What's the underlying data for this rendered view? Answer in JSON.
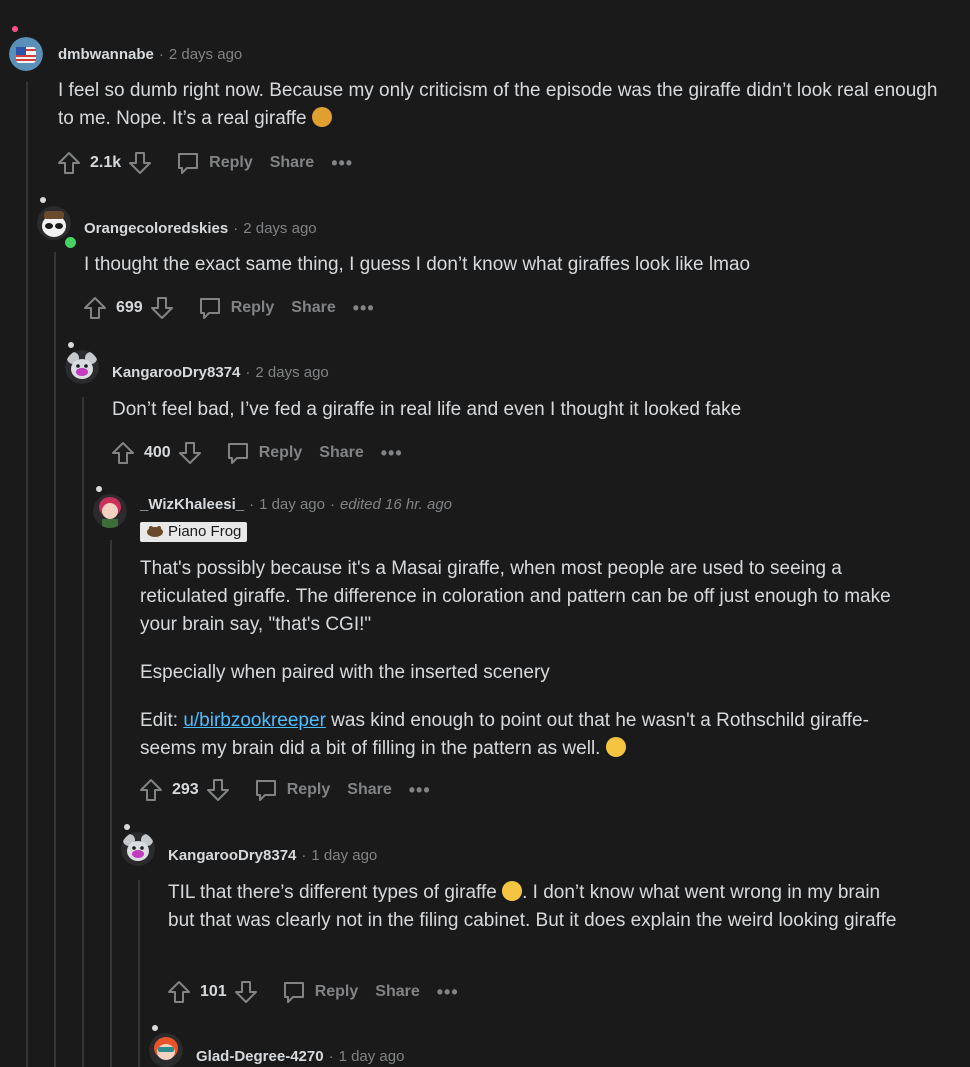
{
  "comments": [
    {
      "username": "dmbwannabe",
      "time": "2 days ago",
      "body": [
        "I feel so dumb right now. Because my only criticism of the episode was the giraffe didn’t look real enough to me. Nope. It’s a real giraffe"
      ],
      "score": "2.1k",
      "emoji": "giraffe-emoji"
    },
    {
      "username": "Orangecoloredskies",
      "time": "2 days ago",
      "body": [
        "I thought the exact same thing, I guess I don’t know what giraffes look like lmao"
      ],
      "score": "699"
    },
    {
      "username": "KangarooDry8374",
      "time": "2 days ago",
      "body": [
        "Don’t feel bad, I’ve fed a giraffe in real life and even I thought it looked fake"
      ],
      "score": "400"
    },
    {
      "username": "_WizKhaleesi_",
      "time": "1 day ago",
      "edited": "edited 16 hr. ago",
      "flair": "Piano Frog",
      "body": [
        "That's possibly because it's a Masai giraffe, when most people are used to seeing a reticulated giraffe. The difference in coloration and pattern can be off just enough to make your brain say, \"that's CGI!\"",
        "Especially when paired with the inserted scenery"
      ],
      "edit_prefix": "Edit: ",
      "edit_link": "u/birbzookreeper",
      "edit_rest": " was kind enough to point out that he wasn't a Rothschild giraffe- seems my brain did a bit of filling in the pattern as well.",
      "score": "293"
    },
    {
      "username": "KangarooDry8374",
      "time": "1 day ago",
      "body_pre": "TIL that there’s different types of giraffe ",
      "body_post": ". I don’t know what went wrong in my brain but that was clearly not in the filing cabinet. But it does explain the weird looking giraffe",
      "score": "101"
    },
    {
      "username": "Glad-Degree-4270",
      "time": "1 day ago"
    }
  ],
  "actions": {
    "reply": "Reply",
    "share": "Share",
    "more": "•••"
  },
  "separator": "·",
  "colors": {
    "background": "#1a1a1b",
    "text": "#d7dadc",
    "muted": "#818384",
    "link": "#4fbcff",
    "thread_line": "#343536",
    "online": "#46d160"
  }
}
